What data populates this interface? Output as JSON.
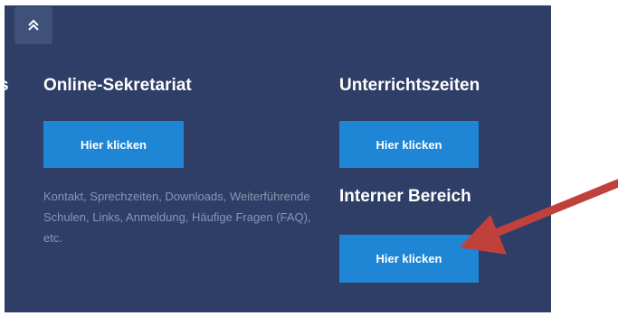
{
  "scroll_top": {
    "icon": "double-chevron-up-icon"
  },
  "columns": {
    "clipped_title": "s",
    "online_sekretariat": {
      "title": "Online-Sekretariat",
      "button_label": "Hier klicken",
      "description": "Kontakt, Sprechzeiten, Downloads, Weiterführende Schulen, Links, Anmeldung, Häufige Fragen (FAQ), etc."
    },
    "unterrichtszeiten": {
      "title": "Unterrichtszeiten",
      "button_label": "Hier klicken"
    },
    "interner_bereich": {
      "title": "Interner Bereich",
      "button_label": "Hier klicken"
    }
  },
  "colors": {
    "panel_background": "#2e3e66",
    "button_blue": "#1f86d6",
    "annotation_arrow": "#c0413b"
  }
}
